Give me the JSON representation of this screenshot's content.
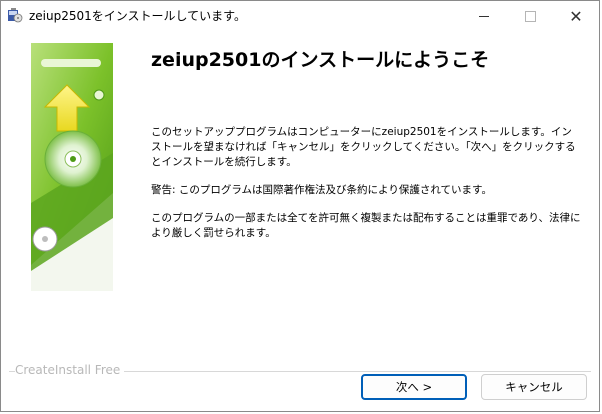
{
  "window": {
    "title": "zeiup2501をインストールしています。",
    "controls": {
      "minimize": "—",
      "maximize": "",
      "close": "✕"
    }
  },
  "content": {
    "heading": "zeiup2501のインストールにようこそ",
    "paragraph1": "このセットアッププログラムはコンピューターにzeiup2501をインストールします。インストールを望まなければ「キャンセル」をクリックしてください。「次へ」をクリックするとインストールを続行します。",
    "paragraph2": "警告: このプログラムは国際著作権法及び条約により保護されています。",
    "paragraph3": "このプログラムの一部または全てを許可無く複製または配布することは重罪であり、法律により厳しく罰せられます。"
  },
  "footer": {
    "brand": "CreateInstall Free",
    "next_label": "次へ >",
    "cancel_label": "キャンセル"
  },
  "colors": {
    "accent": "#005fb8",
    "graphic_green": "#7cc12a",
    "arrow_yellow": "#f2e62a"
  },
  "icons": [
    "installer-icon",
    "minimize-icon",
    "maximize-icon",
    "close-icon",
    "install-arrow-icon",
    "cd-disc-icon"
  ]
}
